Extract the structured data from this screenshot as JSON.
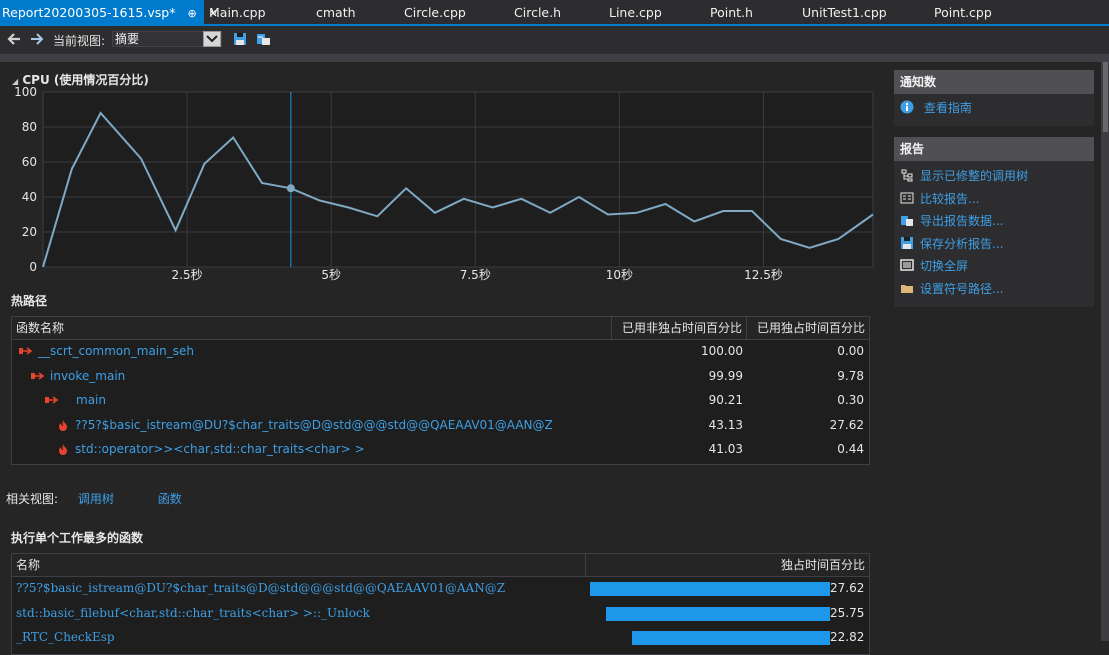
{
  "tabs": [
    {
      "label": "Report20200305-1615.vsp*",
      "active": true
    },
    {
      "label": "Main.cpp"
    },
    {
      "label": "cmath"
    },
    {
      "label": "Circle.cpp"
    },
    {
      "label": "Circle.h"
    },
    {
      "label": "Line.cpp"
    },
    {
      "label": "Point.h"
    },
    {
      "label": "UnitTest1.cpp"
    },
    {
      "label": "Point.cpp"
    }
  ],
  "tab_symbols": {
    "pin": "⊕",
    "close": "✕"
  },
  "toolbar": {
    "view_label": "当前视图:",
    "view_value": "摘要",
    "icons": [
      "back-arrow-icon",
      "forward-arrow-icon",
      "save-icon",
      "export-icon"
    ]
  },
  "cpu": {
    "title": "CPU (使用情况百分比)",
    "collapse_glyph": "◢"
  },
  "chart_data": {
    "type": "line",
    "title": "CPU (使用情况百分比)",
    "ylim": [
      0,
      100
    ],
    "xlim": [
      0,
      14.4
    ],
    "yticks": [
      0,
      20,
      40,
      60,
      80,
      100
    ],
    "xticks": [
      {
        "v": 2.5,
        "label": "2.5秒"
      },
      {
        "v": 5,
        "label": "5秒"
      },
      {
        "v": 7.5,
        "label": "7.5秒"
      },
      {
        "v": 10,
        "label": "10秒"
      },
      {
        "v": 12.5,
        "label": "12.5秒"
      }
    ],
    "x": [
      0,
      0.5,
      1,
      1.7,
      2.3,
      2.8,
      3.3,
      3.8,
      4.3,
      4.8,
      5.3,
      5.8,
      6.3,
      6.8,
      7.3,
      7.8,
      8.3,
      8.8,
      9.3,
      9.8,
      10.3,
      10.8,
      11.3,
      11.8,
      12.3,
      12.8,
      13.3,
      13.8,
      14.4
    ],
    "y": [
      0,
      56,
      88,
      62,
      21,
      59,
      74,
      48,
      45,
      38,
      34,
      29,
      45,
      31,
      39,
      34,
      39,
      31,
      40,
      30,
      31,
      36,
      26,
      32,
      32,
      16,
      11,
      16,
      30
    ],
    "marker": {
      "x": 4.3,
      "y": 45
    },
    "grid": true,
    "line_color": "#7fa9c4"
  },
  "hotpath": {
    "title": "热路径",
    "columns": [
      "函数名称",
      "已用非独占时间百分比",
      "已用独占时间百分比"
    ],
    "rows": [
      {
        "name": "__scrt_common_main_seh",
        "inclusive": "100.00",
        "exclusive": "0.00",
        "icon": "call-path-icon",
        "indent": 0
      },
      {
        "name": "invoke_main",
        "inclusive": "99.99",
        "exclusive": "9.78",
        "icon": "call-path-icon",
        "indent": 1
      },
      {
        "name": "main",
        "inclusive": "90.21",
        "exclusive": "0.30",
        "icon": "call-path-icon",
        "indent": 2
      },
      {
        "name": "??5?$basic_istream@DU?$char_traits@D@std@@@std@@QAEAAV01@AAN@Z",
        "inclusive": "43.13",
        "exclusive": "27.62",
        "icon": "hot-flame-icon",
        "indent": 3
      },
      {
        "name": "std::operator>><char,std::char_traits<char> >",
        "inclusive": "41.03",
        "exclusive": "0.44",
        "icon": "hot-flame-icon",
        "indent": 3
      }
    ]
  },
  "related": {
    "label": "相关视图:",
    "links": [
      "调用树",
      "函数"
    ]
  },
  "topfuncs": {
    "title": "执行单个工作最多的函数",
    "columns": [
      "名称",
      "独占时间百分比"
    ],
    "rows": [
      {
        "name": "??5?$basic_istream@DU?$char_traits@D@std@@@std@@QAEAAV01@AAN@Z",
        "value": "27.62",
        "pct": 27.62
      },
      {
        "name": "std::basic_filebuf<char,std::char_traits<char> >::_Unlock",
        "value": "25.75",
        "pct": 25.75
      },
      {
        "name": "_RTC_CheckEsp",
        "value": "22.82",
        "pct": 22.82
      }
    ]
  },
  "notifications": {
    "title": "通知数",
    "items": [
      {
        "label": "查看指南",
        "icon": "info-icon"
      }
    ]
  },
  "report": {
    "title": "报告",
    "items": [
      {
        "label": "显示已修整的调用树",
        "icon": "call-tree-icon"
      },
      {
        "label": "比较报告...",
        "icon": "compare-icon"
      },
      {
        "label": "导出报告数据...",
        "icon": "export-data-icon"
      },
      {
        "label": "保存分析报告...",
        "icon": "save-icon"
      },
      {
        "label": "切换全屏",
        "icon": "fullscreen-icon"
      },
      {
        "label": "设置符号路径...",
        "icon": "folder-icon"
      }
    ]
  }
}
